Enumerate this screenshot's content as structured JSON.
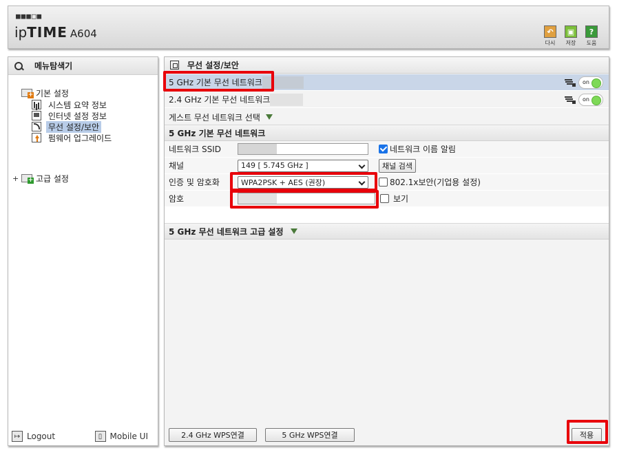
{
  "header": {
    "logo_dots": "■■■□■",
    "brand_light": "ip",
    "brand_bold": "TIME",
    "model": "A604",
    "actions": [
      {
        "label": "다시",
        "icon": "undo-icon",
        "color": "#e0a040"
      },
      {
        "label": "저장",
        "icon": "save-icon",
        "color": "#7cbf3a"
      },
      {
        "label": "도움",
        "icon": "help-icon",
        "color": "#3a9a3a"
      }
    ]
  },
  "sidebar": {
    "title": "메뉴탐색기",
    "groups": [
      {
        "label": "기본 설정"
      },
      {
        "label": "고급 설정"
      }
    ],
    "items": [
      {
        "label": "시스템 요약 정보"
      },
      {
        "label": "인터넷 설정 정보"
      },
      {
        "label": "무선 설정/보안"
      },
      {
        "label": "펌웨어 업그레이드"
      }
    ],
    "expand_symbol": "+",
    "logout_label": "Logout",
    "mobile_label": "Mobile UI"
  },
  "main": {
    "title": "무선 설정/보안",
    "networks": [
      {
        "label": "5 GHz 기본 무선 네트워크",
        "switch": "on"
      },
      {
        "label": "2.4 GHz 기본 무선 네트워크",
        "switch": "on"
      }
    ],
    "guest_label": "게스트 무선 네트워크 선택",
    "section_title": "5 GHz 기본 무선 네트워크",
    "form": {
      "ssid_label": "네트워크 SSID",
      "broadcast_label": "네트워크 이름 알림",
      "channel_label": "채널",
      "channel_value": "149 [ 5.745 GHz ]",
      "channel_search": "채널 검색",
      "auth_label": "인증 및 암호화",
      "auth_value": "WPA2PSK + AES (권장)",
      "enterprise_label": "802.1x보안(기업용 설정)",
      "password_label": "암호",
      "show_label": "보기"
    },
    "advanced_title": "5 GHz 무선 네트워크 고급 설정",
    "wps_24": "2.4 GHz WPS연결",
    "wps_5": "5 GHz WPS연결",
    "apply": "적용"
  },
  "colors": {
    "highlight": "#e8000a",
    "selected_row": "#c9d6e8",
    "toggle_on": "#7ed957"
  }
}
